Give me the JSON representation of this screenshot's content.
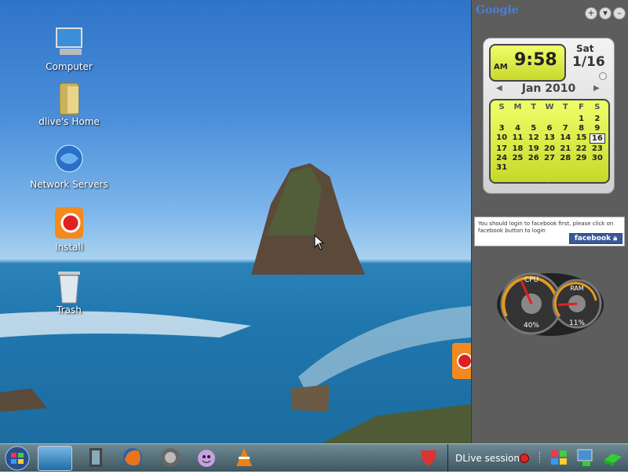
{
  "desktop": {
    "icons": [
      {
        "label": "Computer"
      },
      {
        "label": "dlive's Home"
      },
      {
        "label": "Network Servers"
      },
      {
        "label": "Install"
      },
      {
        "label": "Trash"
      }
    ]
  },
  "sidebar": {
    "logo_text": "Google",
    "buttons": {
      "add": "+",
      "menu": "▾",
      "minimize": "–"
    }
  },
  "clock": {
    "ampm": "AM",
    "time": "9:58",
    "day_name": "Sat",
    "date": "1/16",
    "month_year": "Jan 2010",
    "prev_arrow": "◀",
    "next_arrow": "▶",
    "expand": "⌃",
    "weekdays": [
      "S",
      "M",
      "T",
      "W",
      "T",
      "F",
      "S"
    ],
    "days": [
      "",
      "",
      "",
      "",
      "",
      "1",
      "2",
      "3",
      "4",
      "5",
      "6",
      "7",
      "8",
      "9",
      "10",
      "11",
      "12",
      "13",
      "14",
      "15",
      "16",
      "17",
      "18",
      "19",
      "20",
      "21",
      "22",
      "23",
      "24",
      "25",
      "26",
      "27",
      "28",
      "29",
      "30",
      "31",
      "",
      "",
      "",
      "",
      "",
      ""
    ],
    "today": "16"
  },
  "facebook": {
    "message": "You should login to facebook first, please click on facebook button to login",
    "button": "facebook"
  },
  "meters": {
    "cpu_label": "CPU",
    "cpu_value": "40%",
    "ram_label": "RAM",
    "ram_value": "11%",
    "cpu_level": 0.4,
    "ram_level": 0.11
  },
  "taskbar": {
    "session_label": "DLive session"
  }
}
